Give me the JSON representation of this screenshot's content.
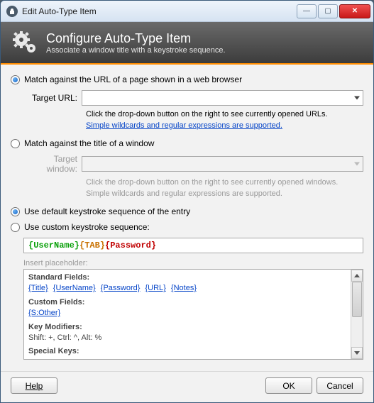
{
  "window": {
    "title": "Edit Auto-Type Item"
  },
  "banner": {
    "title": "Configure Auto-Type Item",
    "subtitle": "Associate a window title with a keystroke sequence."
  },
  "match_url": {
    "radio_label": "Match against the URL of a page shown in a web browser",
    "field_label": "Target URL:",
    "hint1": "Click the drop-down button on the right to see currently opened URLs.",
    "hint2": "Simple wildcards and regular expressions are supported."
  },
  "match_window": {
    "radio_label": "Match against the title of a window",
    "field_label": "Target window:",
    "hint1": "Click the drop-down button on the right to see currently opened windows.",
    "hint2": "Simple wildcards and regular expressions are supported."
  },
  "seq": {
    "default_label": "Use default keystroke sequence of the entry",
    "custom_label": "Use custom keystroke sequence:",
    "part_user": "{UserName}",
    "part_tab": "{TAB}",
    "part_pwd": "{Password}"
  },
  "placeholders": {
    "label": "Insert placeholder:",
    "h_standard": "Standard Fields:",
    "std": {
      "title": "{Title}",
      "user": "{UserName}",
      "pwd": "{Password}",
      "url": "{URL}",
      "notes": "{Notes}"
    },
    "h_custom": "Custom Fields:",
    "custom": "{S:Other}",
    "h_mods": "Key Modifiers:",
    "mods": "Shift: +, Ctrl: ^, Alt: %",
    "h_special": "Special Keys:"
  },
  "buttons": {
    "help": "Help",
    "ok": "OK",
    "cancel": "Cancel"
  }
}
